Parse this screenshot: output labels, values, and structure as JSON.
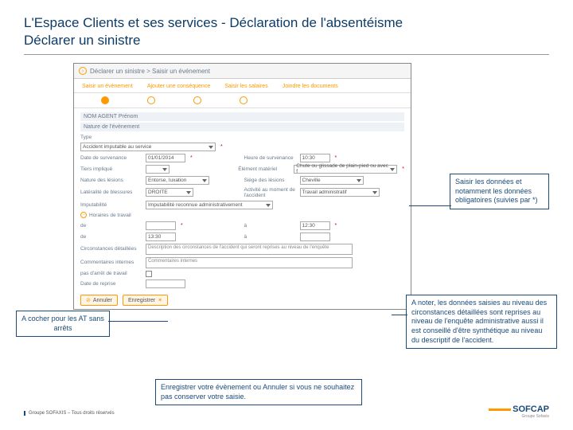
{
  "title_line1": "L'Espace Clients et ses services - Déclaration de l'absentéisme",
  "title_line2": "Déclarer un sinistre",
  "breadcrumb": "Déclarer un sinistre > Saisir un événement",
  "tabs": [
    "Saisir un évènement",
    "Ajouter une conséquence",
    "Saisir les salaires",
    "Joindre les documents"
  ],
  "agent_label": "NOM AGENT Prénom",
  "section_nature": "Nature de l'évènement",
  "fields": {
    "type_label": "Type",
    "type_value": "Accident imputable au service",
    "date_surv_label": "Date de survenance",
    "date_surv_value": "01/01/2014",
    "heure_surv_label": "Heure de survenance",
    "heure_surv_value": "10:30",
    "tiers_label": "Tiers impliqué",
    "tiers_value": "",
    "elem_mat_label": "Élément matériel",
    "elem_mat_value": "Chute ou glissade de plain-pied ou avec f",
    "nature_les_label": "Nature des lésions",
    "nature_les_value": "Entorse, luxation",
    "siege_les_label": "Siège des lésions",
    "siege_les_value": "Cheville",
    "lat_label": "Latéralité de blessures",
    "lat_value": "DROITE",
    "act_label": "Activité au moment de l'accident",
    "act_value": "Travail administratif",
    "imput_label": "Imputabilité",
    "imput_value": "Imputabilité reconnue administrativement",
    "horaires_label": "Horaires de travail",
    "de_label": "de",
    "de1_value": "",
    "a_label": "à",
    "a1_value": "",
    "de2_value": "13:30",
    "a2_value": "",
    "de3_label": "de",
    "de3_value": "",
    "a3_value": "12:30",
    "circ_label": "Circonstances détaillées",
    "circ_value": "Description des circonstances de l'accident qui seront reprises au niveau de l'enquête",
    "comm_label": "Commentaires internes",
    "comm_value": "Commentaires internes",
    "arret_label": "pas d'arrêt de travail",
    "reprise_label": "Date de reprise",
    "reprise_value": ""
  },
  "buttons": {
    "annuler": "Annuler",
    "enregistrer": "Enregistrer"
  },
  "callouts": {
    "c1": "Saisir les données et notamment les données obligatoires (suivies par *)",
    "c2": "A cocher pour les AT sans arrêts",
    "c3": "A noter, les données saisies au niveau des circonstances détaillées sont reprises au niveau de l'enquête administrative aussi il est conseillé d'être synthétique au niveau du descriptif de l'accident.",
    "c4": "Enregistrer votre évènement ou Annuler si vous ne souhaitez pas conserver votre saisie."
  },
  "footer": {
    "left": "Groupe SOFAXIS – Tous droits réservés",
    "brand": "SOFCAP",
    "brand_sub": "Groupe Sofaxis"
  }
}
